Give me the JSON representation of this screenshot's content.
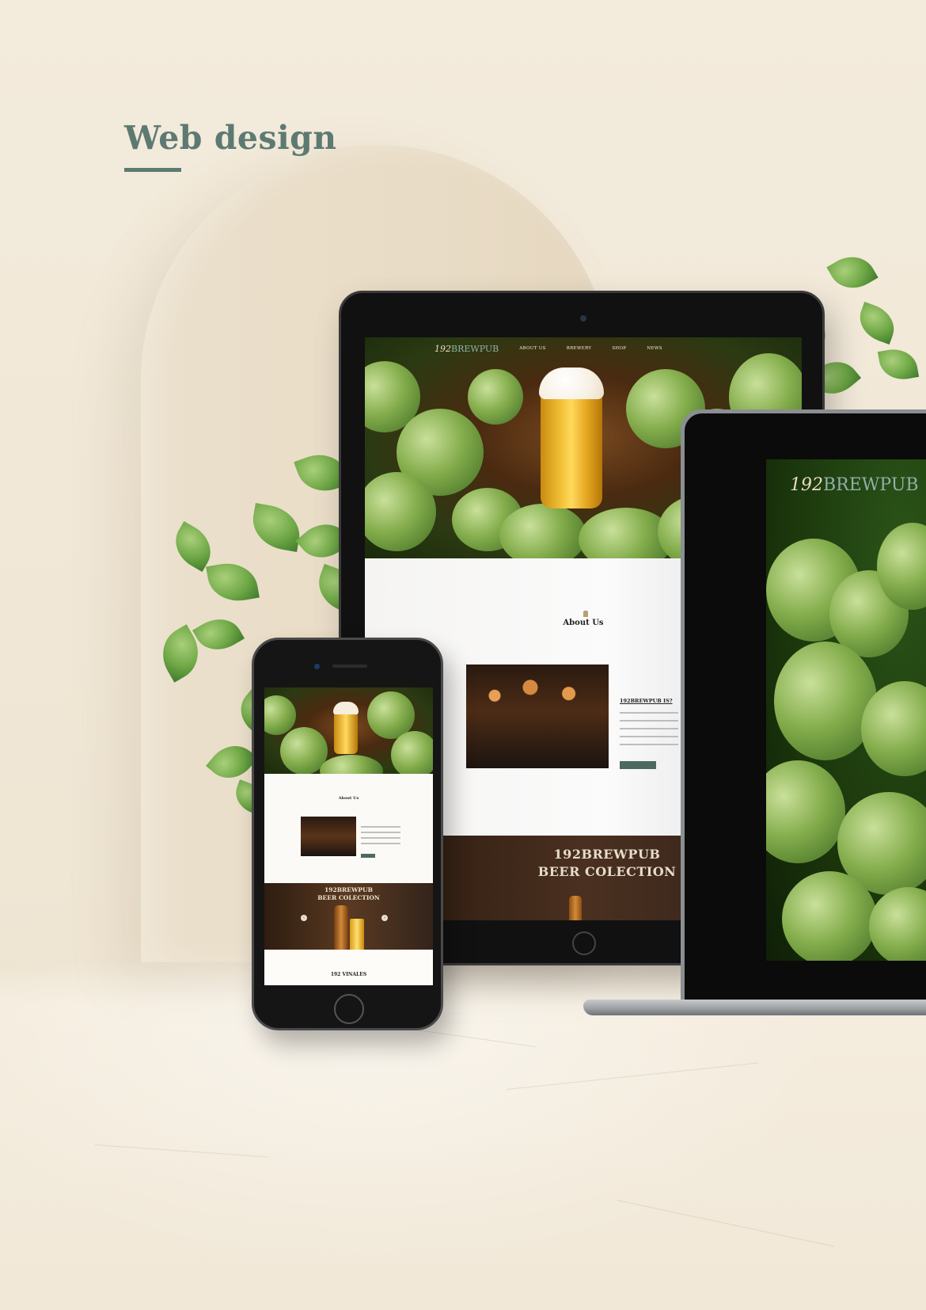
{
  "heading": "Web design",
  "colors": {
    "accent": "#5d7a72",
    "background": "#f2e9da",
    "button": "#4d6a62"
  },
  "tablet": {
    "nav": {
      "logo_prefix": "192",
      "logo_suffix": "BREWPUB",
      "items": [
        "ABOUT US",
        "BREWERY",
        "SHOP",
        "NEWS"
      ]
    },
    "about": {
      "title": "About Us",
      "heading": "192BREWPUB IS?"
    },
    "collection": {
      "line1": "192BREWPUB",
      "line2": "BEER COLECTION"
    }
  },
  "laptop": {
    "logo_prefix": "192",
    "logo_suffix": "BREWPUB"
  },
  "phone": {
    "about_title": "About Us",
    "collection_line1": "192BREWPUB",
    "collection_line2": "BEER COLECTION",
    "vinales_title": "192 VINALES",
    "icons": {
      "prev": "chevron-left-icon",
      "next": "chevron-right-icon"
    }
  }
}
